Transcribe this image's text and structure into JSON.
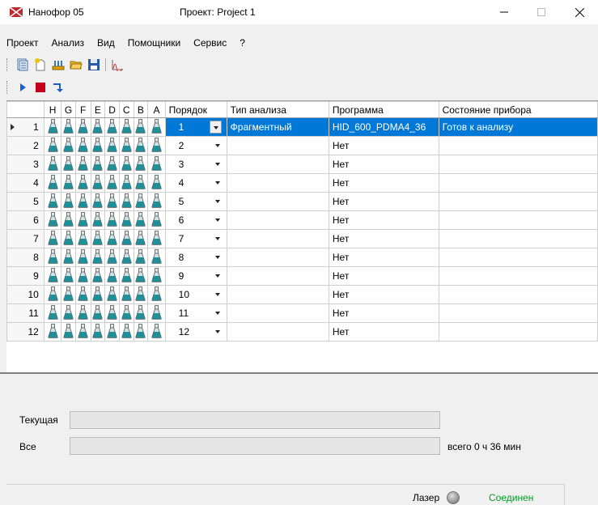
{
  "window": {
    "app_title": "Нанофор 05",
    "project_title": "Проект: Project 1",
    "brand_color": "#c0282d"
  },
  "menu": [
    "Проект",
    "Анализ",
    "Вид",
    "Помощники",
    "Сервис",
    "?"
  ],
  "toolbar1": [
    "table-icon",
    "new-file-icon",
    "sample-rack-icon",
    "open-folder-icon",
    "save-disk-icon",
    "chart-peak-icon"
  ],
  "toolbar2": [
    "play-icon",
    "stop-icon",
    "step-into-icon"
  ],
  "grid": {
    "columns": {
      "wells": [
        "H",
        "G",
        "F",
        "E",
        "D",
        "C",
        "B",
        "A"
      ],
      "order": "Порядок",
      "analysis_type": "Тип анализа",
      "program": "Программа",
      "device_state": "Состояние прибора"
    },
    "selection_color": "#0078d7",
    "rows": [
      {
        "num": "1",
        "order": "1",
        "analysis_type": "Фрагментный",
        "program": "HID_600_PDMA4_36",
        "device_state": "Готов к анализу"
      },
      {
        "num": "2",
        "order": "2",
        "analysis_type": "",
        "program": "Нет",
        "device_state": ""
      },
      {
        "num": "3",
        "order": "3",
        "analysis_type": "",
        "program": "Нет",
        "device_state": ""
      },
      {
        "num": "4",
        "order": "4",
        "analysis_type": "",
        "program": "Нет",
        "device_state": ""
      },
      {
        "num": "5",
        "order": "5",
        "analysis_type": "",
        "program": "Нет",
        "device_state": ""
      },
      {
        "num": "6",
        "order": "6",
        "analysis_type": "",
        "program": "Нет",
        "device_state": ""
      },
      {
        "num": "7",
        "order": "7",
        "analysis_type": "",
        "program": "Нет",
        "device_state": ""
      },
      {
        "num": "8",
        "order": "8",
        "analysis_type": "",
        "program": "Нет",
        "device_state": ""
      },
      {
        "num": "9",
        "order": "9",
        "analysis_type": "",
        "program": "Нет",
        "device_state": ""
      },
      {
        "num": "10",
        "order": "10",
        "analysis_type": "",
        "program": "Нет",
        "device_state": ""
      },
      {
        "num": "11",
        "order": "11",
        "analysis_type": "",
        "program": "Нет",
        "device_state": ""
      },
      {
        "num": "12",
        "order": "12",
        "analysis_type": "",
        "program": "Нет",
        "device_state": ""
      }
    ]
  },
  "progress": {
    "current_label": "Текущая",
    "all_label": "Все",
    "total_text": "всего 0 ч 36 мин",
    "current_fraction": 0,
    "all_fraction": 0
  },
  "status": {
    "laser_label": "Лазер",
    "connection_text": "Соединен",
    "connection_color": "#00a020"
  }
}
